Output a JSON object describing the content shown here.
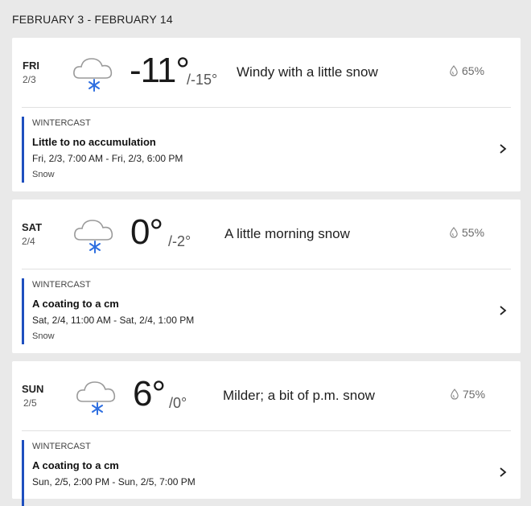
{
  "date_range": "FEBRUARY 3 - FEBRUARY 14",
  "colors": {
    "accent": "#1e4fbf",
    "snowflake": "#2f6fe0",
    "background": "#e9e9e9"
  },
  "days": [
    {
      "day": "FRI",
      "date": "2/3",
      "icon": "cloud-snow-icon",
      "high": "-11°",
      "low": "/-15°",
      "phrase": "Windy with a little snow",
      "precip": "65%",
      "wintercast": {
        "tag": "WINTERCAST",
        "title": "Little to no accumulation",
        "time": "Fri, 2/3, 7:00 AM - Fri, 2/3, 6:00 PM",
        "type": "Snow"
      }
    },
    {
      "day": "SAT",
      "date": "2/4",
      "icon": "cloud-snow-icon",
      "high": "0°",
      "low": "/-2°",
      "phrase": "A little morning snow",
      "precip": "55%",
      "wintercast": {
        "tag": "WINTERCAST",
        "title": "A coating to a cm",
        "time": "Sat, 2/4, 11:00 AM - Sat, 2/4, 1:00 PM",
        "type": "Snow"
      }
    },
    {
      "day": "SUN",
      "date": "2/5",
      "icon": "cloud-snow-icon",
      "high": "6°",
      "low": "/0°",
      "phrase": "Milder; a bit of p.m. snow",
      "precip": "75%",
      "wintercast": {
        "tag": "WINTERCAST",
        "title": "A coating to a cm",
        "time": "Sun, 2/5, 2:00 PM - Sun, 2/5, 7:00 PM"
      }
    }
  ]
}
